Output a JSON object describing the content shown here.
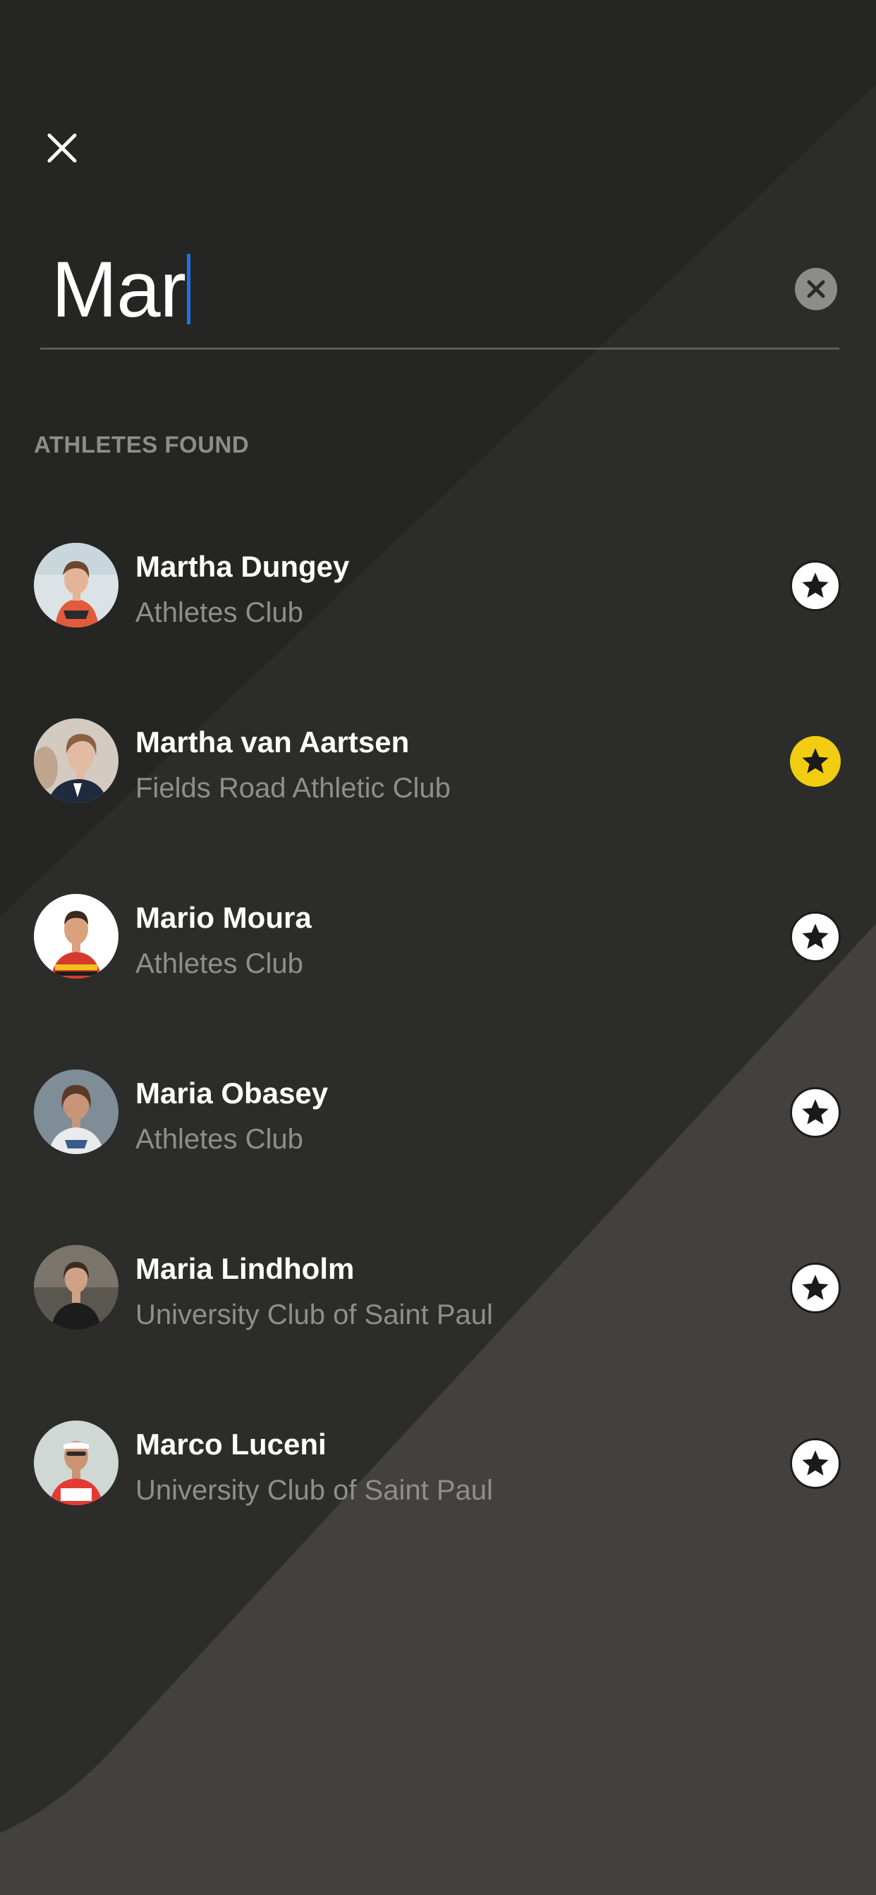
{
  "search": {
    "value": "Mar"
  },
  "results_header": "ATHLETES FOUND",
  "colors": {
    "background": "#252523",
    "favorite_active": "#f2cc10",
    "caret": "#1a73e8",
    "secondary_text": "#8e8e8a"
  },
  "icons": {
    "close": "close-icon",
    "clear": "clear-icon",
    "favorite": "star-icon"
  },
  "athletes": [
    {
      "name": "Martha Dungey",
      "club": "Athletes Club",
      "favorite": false
    },
    {
      "name": "Martha van Aartsen",
      "club": "Fields Road Athletic Club",
      "favorite": true
    },
    {
      "name": "Mario Moura",
      "club": "Athletes Club",
      "favorite": false
    },
    {
      "name": "Maria Obasey",
      "club": "Athletes Club",
      "favorite": false
    },
    {
      "name": "Maria Lindholm",
      "club": "University Club of Saint Paul",
      "favorite": false
    },
    {
      "name": "Marco Luceni",
      "club": "University Club of Saint Paul",
      "favorite": false
    }
  ]
}
